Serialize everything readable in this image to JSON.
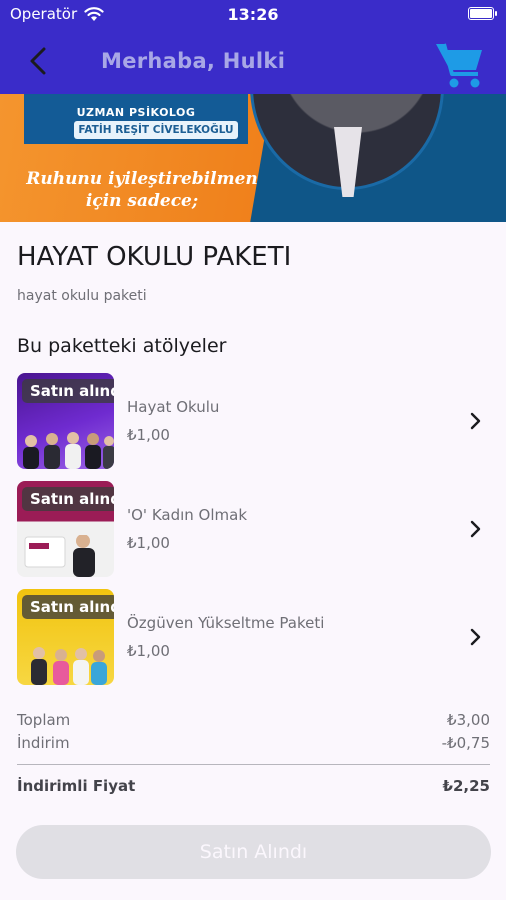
{
  "status_bar": {
    "carrier": "Operatör",
    "time": "13:26"
  },
  "header": {
    "greeting": "Merhaba, Hulki"
  },
  "banner": {
    "title": "UZMAN PSİKOLOG",
    "name": "FATİH REŞİT CİVELEKOĞLU",
    "slogan": "Ruhunu iyileştirebilmen için sadece;"
  },
  "package": {
    "title": "HAYAT OKULU PAKETI",
    "description": "hayat okulu paketi",
    "section_title": "Bu paketteki atölyeler"
  },
  "items": [
    {
      "badge": "Satın alındı",
      "name": "Hayat Okulu",
      "price": "₺1,00"
    },
    {
      "badge": "Satın alındı",
      "name": "'O' Kadın Olmak",
      "price": "₺1,00"
    },
    {
      "badge": "Satın alındı",
      "name": "Özgüven Yükseltme Paketi",
      "price": "₺1,00"
    }
  ],
  "summary": {
    "total_label": "Toplam",
    "total_value": "₺3,00",
    "discount_label": "İndirim",
    "discount_value": "-₺0,75",
    "final_label": "İndirimli Fiyat",
    "final_value": "₺2,25"
  },
  "button": {
    "label": "Satın Alındı"
  },
  "colors": {
    "header": "#3a2cc9",
    "cart_icon": "#1e9be6",
    "greeting": "#a8a7e6"
  }
}
